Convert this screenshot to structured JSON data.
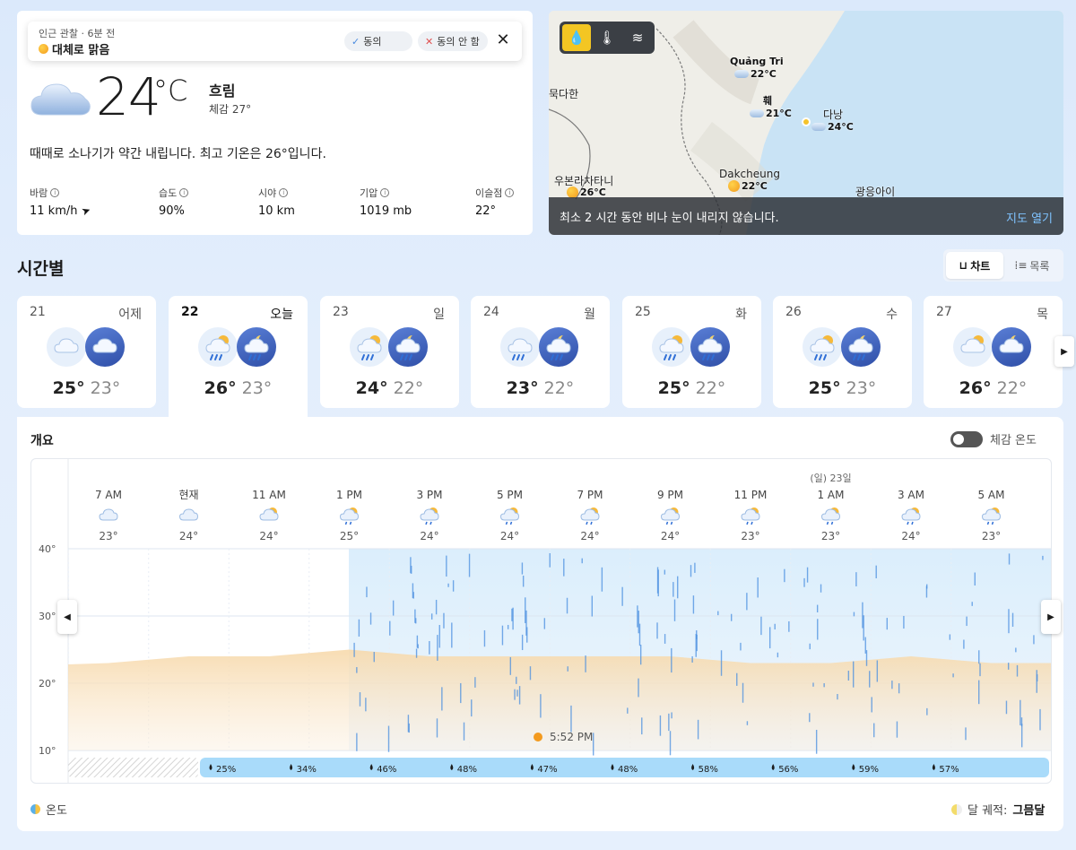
{
  "toast": {
    "subtitle": "인근 관찰 · 6분 전",
    "title": "대체로 맑음",
    "agree": "동의",
    "disagree": "동의 안 함"
  },
  "current": {
    "temp": "24",
    "unit": "°C",
    "condition": "흐림",
    "feels_like": "체감   27°",
    "summary": "때때로 소나기가 약간 내립니다. 최고 기온은 26°입니다.",
    "stats": [
      {
        "label": "바람",
        "value": "11 km/h"
      },
      {
        "label": "습도",
        "value": "90%"
      },
      {
        "label": "시야",
        "value": "10 km"
      },
      {
        "label": "기압",
        "value": "1019 mb"
      },
      {
        "label": "이슬점",
        "value": "22°"
      }
    ]
  },
  "map": {
    "labels": {
      "quang_tri": "Quảng Tri",
      "quang_tri_temp": "22°C",
      "hue": "훼",
      "hue_temp": "21°C",
      "danang": "다낭",
      "danang_temp": "24°C",
      "mukdahan": "묵다한",
      "ubon": "우본라차타니",
      "ubon_temp": "26°C",
      "dakcheung": "Dakcheung",
      "dakcheung_temp": "22°C",
      "quangngai": "광응아이"
    },
    "footer_text": "최소 2 시간 동안 비나 눈이 내리지 않습니다.",
    "open_link": "지도 열기"
  },
  "hourly": {
    "title": "시간별",
    "chart_btn": "차트",
    "list_btn": "목록"
  },
  "days": [
    {
      "num": "21",
      "name": "어제",
      "hi": "25°",
      "lo": "23°"
    },
    {
      "num": "22",
      "name": "오늘",
      "hi": "26°",
      "lo": "23°"
    },
    {
      "num": "23",
      "name": "일",
      "hi": "24°",
      "lo": "22°"
    },
    {
      "num": "24",
      "name": "월",
      "hi": "23°",
      "lo": "22°"
    },
    {
      "num": "25",
      "name": "화",
      "hi": "25°",
      "lo": "22°"
    },
    {
      "num": "26",
      "name": "수",
      "hi": "25°",
      "lo": "23°"
    },
    {
      "num": "27",
      "name": "목",
      "hi": "26°",
      "lo": "22°"
    }
  ],
  "overview": {
    "title": "개요",
    "feels_toggle": "체감 온도",
    "legend_temp": "온도",
    "moon_label": "달 궤적: ",
    "moon_value": "그믐달",
    "sunset": "5:52 PM",
    "next_day_label": "(일) 23일"
  },
  "chart_data": {
    "type": "area",
    "x": [
      "7 AM",
      "현재",
      "11 AM",
      "1 PM",
      "3 PM",
      "5 PM",
      "7 PM",
      "9 PM",
      "11 PM",
      "1 AM",
      "3 AM",
      "5 AM"
    ],
    "temps": [
      23,
      24,
      24,
      25,
      24,
      24,
      24,
      24,
      23,
      23,
      24,
      23
    ],
    "temp_labels": [
      "23°",
      "24°",
      "24°",
      "25°",
      "24°",
      "24°",
      "24°",
      "24°",
      "23°",
      "23°",
      "24°",
      "23°"
    ],
    "yticks": [
      "40°",
      "30°",
      "20°",
      "10°"
    ],
    "ylim": [
      10,
      40
    ],
    "precip": [
      "25%",
      "34%",
      "46%",
      "48%",
      "47%",
      "48%",
      "58%",
      "56%",
      "59%",
      "57%"
    ],
    "colors": {
      "temp": "#f6d8a8",
      "rain": "#4a8fe0",
      "precip_bar": "#a9dbfa"
    }
  }
}
